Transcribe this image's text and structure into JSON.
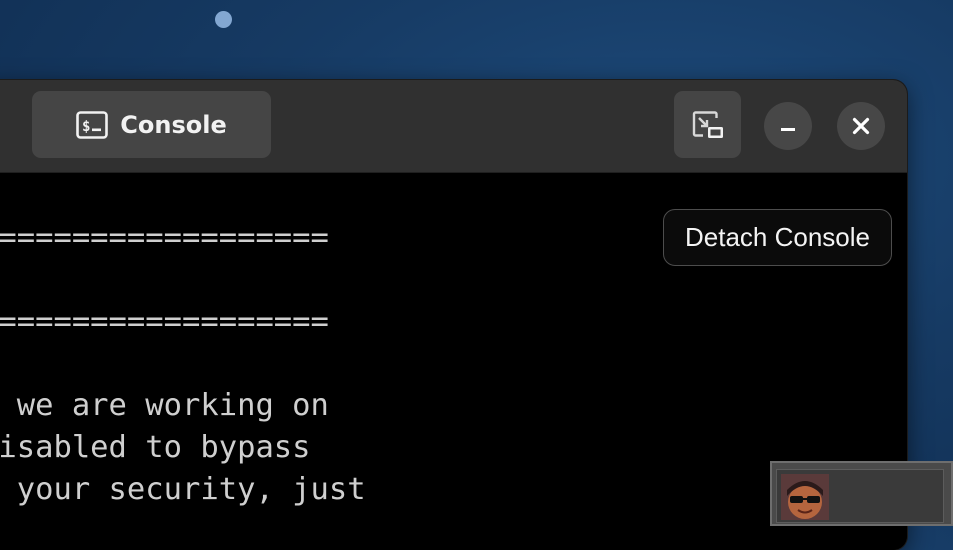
{
  "header": {
    "tab_label": "Console"
  },
  "terminal": {
    "lines": [
      "===================",
      "===================",
      "d we are working on",
      "disabled to bypass",
      "t your security, just"
    ],
    "detach_label": "Detach Console"
  },
  "icons": {
    "tab": "terminal-icon",
    "pip": "picture-in-picture-icon",
    "minimize": "minimize-icon",
    "close": "close-icon",
    "thumbnail": "avatar-thumbnail"
  },
  "colors": {
    "desktop_bg": "#163a63",
    "headerbar": "#303030",
    "tab_bg": "#454545",
    "terminal_bg": "#000000",
    "terminal_text": "#cfcfcf"
  }
}
